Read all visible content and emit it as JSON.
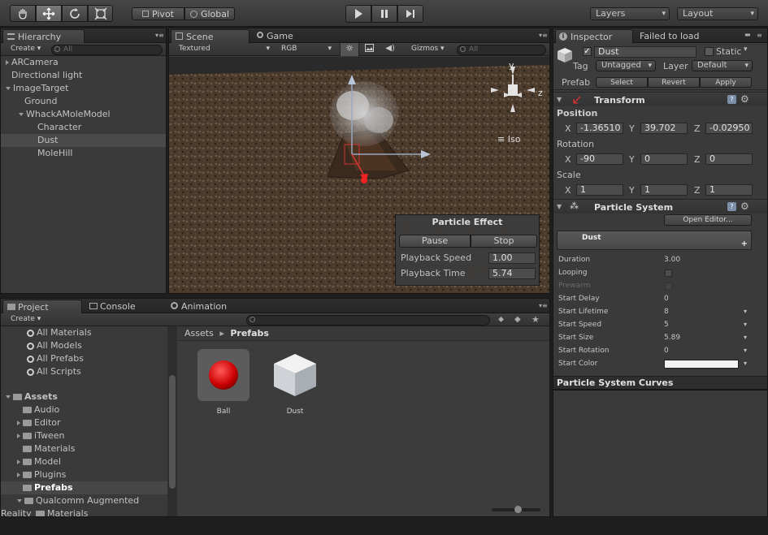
{
  "toolbar": {
    "tools": [
      "hand-icon",
      "move-icon",
      "rotate-icon",
      "scale-icon"
    ],
    "pivot_label": "Pivot",
    "global_label": "Global",
    "layers_label": "Layers",
    "layout_label": "Layout"
  },
  "hierarchy": {
    "tab_label": "Hierarchy",
    "create_label": "Create",
    "search_placeholder": "All",
    "items": [
      {
        "label": "ARCamera",
        "indent": 0,
        "arrow": "right"
      },
      {
        "label": "Directional light",
        "indent": 0,
        "arrow": "none"
      },
      {
        "label": "ImageTarget",
        "indent": 0,
        "arrow": "down"
      },
      {
        "label": "Ground",
        "indent": 1,
        "arrow": "none"
      },
      {
        "label": "WhackAMoleModel",
        "indent": 1,
        "arrow": "down"
      },
      {
        "label": "Character",
        "indent": 2,
        "arrow": "none"
      },
      {
        "label": "Dust",
        "indent": 2,
        "arrow": "none",
        "selected": true
      },
      {
        "label": "MoleHill",
        "indent": 2,
        "arrow": "none"
      }
    ]
  },
  "scene": {
    "scene_tab": "Scene",
    "game_tab": "Game",
    "shading": "Textured",
    "render_mode": "RGB",
    "gizmos_label": "Gizmos",
    "search_placeholder": "All",
    "gizmo_axis_y": "y",
    "gizmo_axis_z": "z",
    "iso_label": "Iso",
    "particle_effect": {
      "title": "Particle Effect",
      "pause_label": "Pause",
      "stop_label": "Stop",
      "playback_speed_label": "Playback Speed",
      "playback_speed_value": "1.00",
      "playback_time_label": "Playback Time",
      "playback_time_value": "5.74"
    }
  },
  "project": {
    "project_tab": "Project",
    "console_tab": "Console",
    "animation_tab": "Animation",
    "create_label": "Create",
    "favorites": [
      "All Materials",
      "All Models",
      "All Prefabs",
      "All Scripts"
    ],
    "assets_label": "Assets",
    "folders": [
      {
        "label": "Audio",
        "arrow": "none"
      },
      {
        "label": "Editor",
        "arrow": "right"
      },
      {
        "label": "iTween",
        "arrow": "right"
      },
      {
        "label": "Materials",
        "arrow": "none"
      },
      {
        "label": "Model",
        "arrow": "right"
      },
      {
        "label": "Plugins",
        "arrow": "right"
      },
      {
        "label": "Prefabs",
        "arrow": "none",
        "selected": true
      },
      {
        "label": "Qualcomm Augmented Reality",
        "arrow": "down"
      },
      {
        "label": "Materials",
        "arrow": "none",
        "sub": true
      }
    ],
    "breadcrumb_root": "Assets",
    "breadcrumb_current": "Prefabs",
    "assets": [
      {
        "label": "Ball",
        "icon": "ball-prefab-icon"
      },
      {
        "label": "Dust",
        "icon": "cube-prefab-icon"
      }
    ]
  },
  "inspector": {
    "inspector_tab": "Inspector",
    "failed_label": "Failed to load",
    "object_name": "Dust",
    "static_label": "Static",
    "tag_label": "Tag",
    "tag_value": "Untagged",
    "layer_label": "Layer",
    "layer_value": "Default",
    "prefab_label": "Prefab",
    "select_label": "Select",
    "revert_label": "Revert",
    "apply_label": "Apply",
    "transform_label": "Transform",
    "position_label": "Position",
    "rotation_label": "Rotation",
    "scale_label": "Scale",
    "axis_x": "X",
    "axis_y": "Y",
    "axis_z": "Z",
    "position": {
      "x": "-1.36510",
      "y": "39.702",
      "z": "-0.02950"
    },
    "rotation": {
      "x": "-90",
      "y": "0",
      "z": "0"
    },
    "scale": {
      "x": "1",
      "y": "1",
      "z": "1"
    },
    "particle_system_label": "Particle System",
    "open_editor_label": "Open Editor...",
    "module_name": "Dust",
    "properties": [
      {
        "label": "Duration",
        "value": "3.00",
        "arrow": false
      },
      {
        "label": "Looping",
        "value": "",
        "checkbox": true,
        "arrow": false
      },
      {
        "label": "Prewarm",
        "value": "",
        "checkbox": true,
        "disabled": true,
        "arrow": false
      },
      {
        "label": "Start Delay",
        "value": "0",
        "arrow": false
      },
      {
        "label": "Start Lifetime",
        "value": "8",
        "arrow": true
      },
      {
        "label": "Start Speed",
        "value": "5",
        "arrow": true
      },
      {
        "label": "Start Size",
        "value": "5.89",
        "arrow": true
      },
      {
        "label": "Start Rotation",
        "value": "0",
        "arrow": true
      },
      {
        "label": "Start Color",
        "value": "",
        "color": "#f2f2f2",
        "arrow": true
      }
    ],
    "curves_label": "Particle System Curves"
  },
  "colors": {
    "accent_red": "#e02020",
    "gizmo_x": "#d33",
    "ground": "#4a3a2c"
  }
}
